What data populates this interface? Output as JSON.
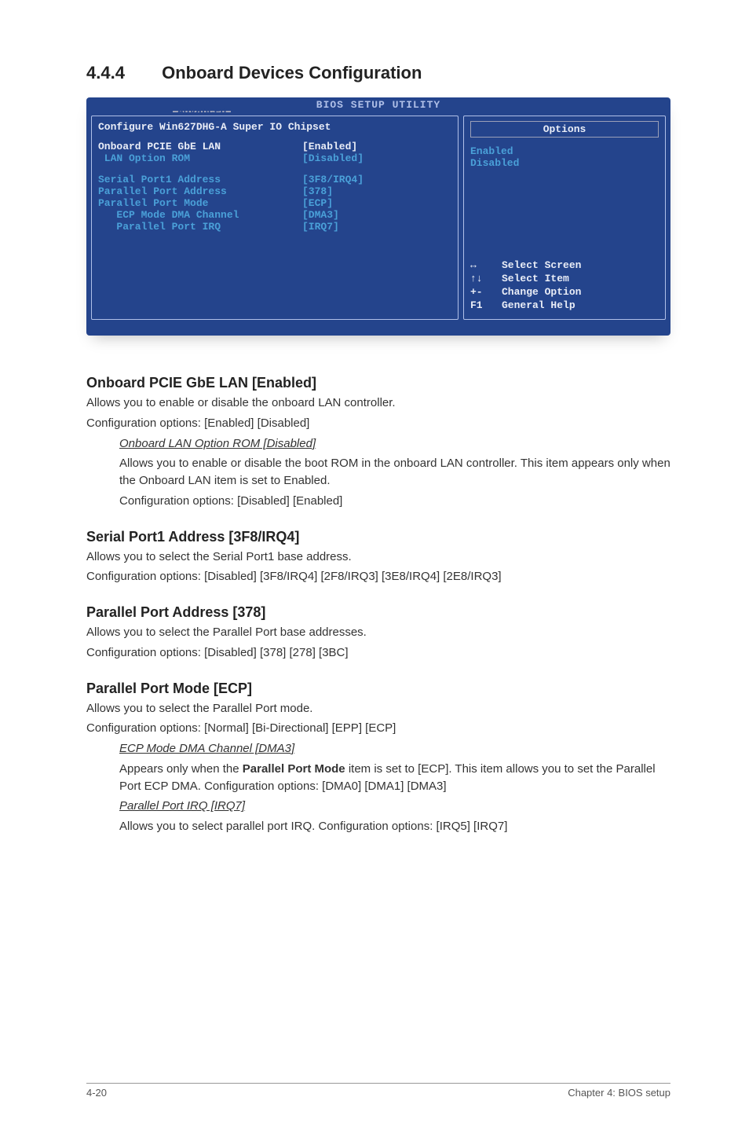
{
  "heading": {
    "number": "4.4.4",
    "title": "Onboard Devices Configuration"
  },
  "bios": {
    "utility_title": "BIOS SETUP UTILITY",
    "tab": "Advanced",
    "panel_header": "Configure Win627DHG-A Super IO Chipset",
    "items": [
      {
        "label": "Onboard PCIE GbE LAN",
        "value": "[Enabled]",
        "hl": true
      },
      {
        "label": " LAN Option ROM",
        "value": "[Disabled]",
        "blue": true
      },
      {
        "spacer": true
      },
      {
        "label": "Serial Port1 Address",
        "value": "[3F8/IRQ4]",
        "blue": true
      },
      {
        "label": "Parallel Port Address",
        "value": "[378]",
        "blue": true
      },
      {
        "label": "Parallel Port Mode",
        "value": "[ECP]",
        "blue": true
      },
      {
        "label": "   ECP Mode DMA Channel",
        "value": "[DMA3]",
        "blue": true
      },
      {
        "label": "   Parallel Port IRQ",
        "value": "[IRQ7]",
        "blue": true
      }
    ],
    "options_header": "Options",
    "options": [
      "Enabled",
      "Disabled"
    ],
    "help": [
      {
        "sym": "↔",
        "text": "Select Screen"
      },
      {
        "sym": "↑↓",
        "text": "Select Item"
      },
      {
        "sym": "+-",
        "text": "Change Option"
      },
      {
        "sym": "F1",
        "text": "General Help"
      }
    ]
  },
  "sections": {
    "s1": {
      "title": "Onboard PCIE GbE LAN [Enabled]",
      "p1": "Allows you to enable or disable the onboard LAN controller.",
      "p2": "Configuration options: [Enabled] [Disabled]",
      "sub_title": "Onboard LAN Option ROM [Disabled]",
      "sub_p1": "Allows you to enable or disable the boot ROM in the onboard LAN controller. This item appears only when the Onboard LAN item is set to Enabled.",
      "sub_p2": "Configuration options: [Disabled] [Enabled]"
    },
    "s2": {
      "title": "Serial Port1 Address [3F8/IRQ4]",
      "p1": "Allows you to select the Serial Port1 base address.",
      "p2": "Configuration options: [Disabled] [3F8/IRQ4] [2F8/IRQ3] [3E8/IRQ4] [2E8/IRQ3]"
    },
    "s3": {
      "title": "Parallel Port Address [378]",
      "p1": "Allows you to select the Parallel Port base addresses.",
      "p2": "Configuration options: [Disabled] [378] [278] [3BC]"
    },
    "s4": {
      "title": "Parallel Port Mode [ECP]",
      "p1": "Allows you to select the Parallel Port  mode.",
      "p2": "Configuration options: [Normal] [Bi-Directional] [EPP] [ECP]",
      "sub1_title": "ECP Mode DMA Channel [DMA3]",
      "sub1_p_a": "Appears only when the ",
      "sub1_bold": "Parallel Port Mode",
      "sub1_p_b": " item is set to [ECP]. This item allows you to set the Parallel Port ECP DMA. Configuration options: [DMA0] [DMA1] [DMA3]",
      "sub2_title": "Parallel Port IRQ [IRQ7]",
      "sub2_p": "Allows you to select parallel port IRQ. Configuration options: [IRQ5] [IRQ7]"
    }
  },
  "footer": {
    "left": "4-20",
    "right": "Chapter 4: BIOS setup"
  }
}
